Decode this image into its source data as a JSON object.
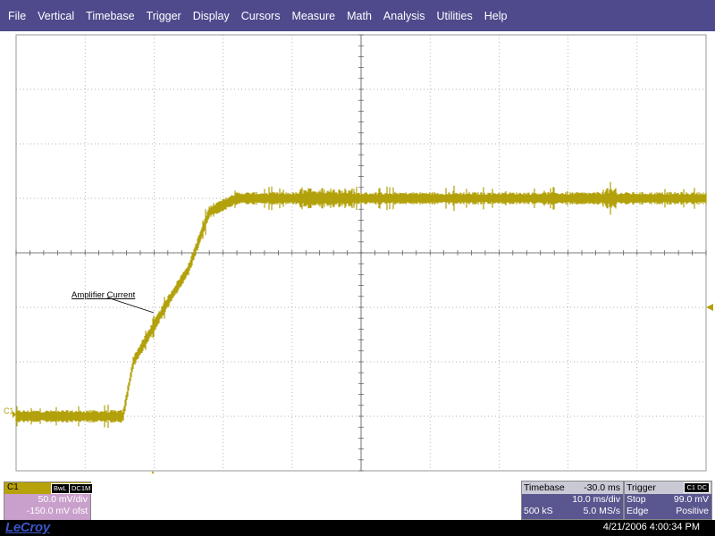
{
  "menu": [
    "File",
    "Vertical",
    "Timebase",
    "Trigger",
    "Display",
    "Cursors",
    "Measure",
    "Math",
    "Analysis",
    "Utilities",
    "Help"
  ],
  "colors": {
    "menubar": "#4e4a8c",
    "trace": "#b2a10a",
    "grid": "#9a9a9a",
    "panel": "#5a568f",
    "channel_panel": "#c9a0cc"
  },
  "screen": {
    "annotation": "Amplifier Current",
    "channel_marker": "C1",
    "trigger_level_marker": "trigger-level-arrow-icon",
    "trigger_time_marker": "trigger-time-arrow-icon"
  },
  "c1": {
    "label": "C1",
    "badge1": "BwL",
    "badge2": "DC1M",
    "vdiv": "50.0 mV/div",
    "offset": "-150.0 mV ofst"
  },
  "timebase": {
    "title": "Timebase",
    "delay": "-30.0 ms",
    "tdiv": "10.0 ms/div",
    "samples": "500 kS",
    "rate": "5.0 MS/s"
  },
  "trigger": {
    "title": "Trigger",
    "badge": "C1 DC",
    "mode": "Stop",
    "level": "99.0 mV",
    "type": "Edge",
    "slope": "Positive"
  },
  "footer": {
    "logo": "LeCroy",
    "datetime": "4/21/2006 4:00:34 PM"
  },
  "chart_data": {
    "type": "line",
    "series": [
      {
        "name": "Amplifier Current",
        "x_div": [
          0,
          1.55,
          1.7,
          2.2,
          2.5,
          2.8,
          3.2,
          10
        ],
        "y_div": [
          -3.0,
          -3.0,
          -2.0,
          -0.9,
          -0.3,
          0.75,
          1.0,
          1.0
        ]
      }
    ],
    "xlim_div": [
      0,
      10
    ],
    "ylim_div": [
      -4,
      4
    ],
    "vdiv": "50.0 mV/div",
    "tdiv": "10.0 ms/div",
    "grid": true
  }
}
